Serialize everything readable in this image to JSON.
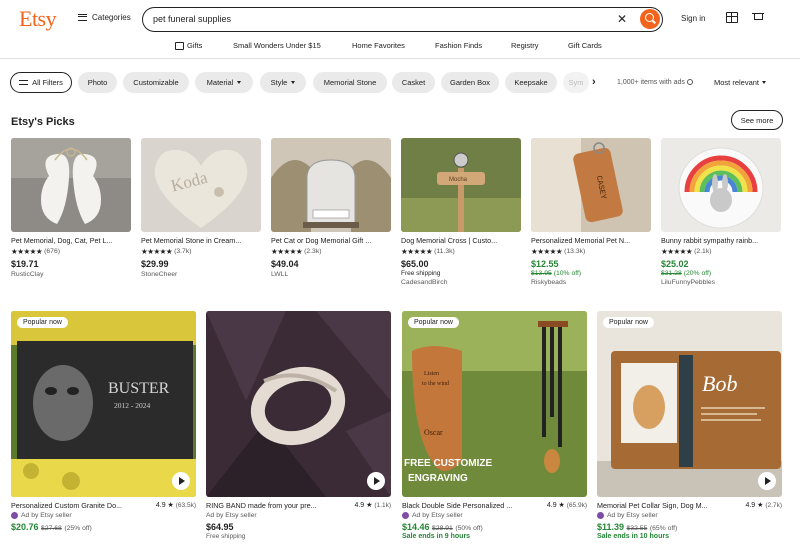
{
  "header": {
    "logo": "Etsy",
    "categories_label": "Categories",
    "search_value": "pet funeral supplies",
    "signin_label": "Sign in"
  },
  "nav": {
    "items": [
      "Gifts",
      "Small Wonders Under $15",
      "Home Favorites",
      "Fashion Finds",
      "Registry",
      "Gift Cards"
    ]
  },
  "filters": {
    "all_filters": "All Filters",
    "chips": [
      "Photo",
      "Customizable",
      "Material",
      "Style",
      "Memorial Stone",
      "Casket",
      "Garden Box",
      "Keepsake",
      "Sym"
    ],
    "results_count": "1,000+ items with ads",
    "sort_label": "Most relevant"
  },
  "picks": {
    "title": "Etsy's Picks",
    "see_more": "See more",
    "items": [
      {
        "title": "Pet Memorial, Dog, Cat, Pet L...",
        "stars": "★★★★★",
        "reviews": "(676)",
        "price": "$19.71",
        "orig": "",
        "pct": "",
        "ship": "",
        "shop": "RusticClay"
      },
      {
        "title": "Pet Memorial Stone in Cream...",
        "stars": "★★★★★",
        "reviews": "(3.7k)",
        "price": "$29.99",
        "orig": "",
        "pct": "",
        "ship": "",
        "shop": "StoneCheer"
      },
      {
        "title": "Pet Cat or Dog Memorial Gift ...",
        "stars": "★★★★★",
        "reviews": "(2.3k)",
        "price": "$49.04",
        "orig": "",
        "pct": "",
        "ship": "",
        "shop": "LWLL"
      },
      {
        "title": "Dog Memorial Cross | Custo...",
        "stars": "★★★★★",
        "reviews": "(11.3k)",
        "price": "$65.00",
        "orig": "",
        "pct": "",
        "ship": "Free shipping",
        "shop": "CadesandBirch"
      },
      {
        "title": "Personalized Memorial Pet N...",
        "stars": "★★★★★",
        "reviews": "(13.3k)",
        "price": "$12.55",
        "orig": "$13.95",
        "pct": "(10% off)",
        "ship": "",
        "shop": "Riskybeads"
      },
      {
        "title": "Bunny rabbit sympathy rainb...",
        "stars": "★★★★★",
        "reviews": "(2.1k)",
        "price": "$25.02",
        "orig": "$31.28",
        "pct": "(20% off)",
        "ship": "",
        "shop": "LiluFunnyPebbles"
      }
    ]
  },
  "cards": [
    {
      "popular": "Popular now",
      "title": "Personalized Custom Granite Do...",
      "rating": "4.9",
      "reviews": "(63.5k)",
      "ad": "Ad by Etsy seller",
      "price": "$20.76",
      "orig": "$27.68",
      "pct": "(25% off)",
      "ship": "",
      "ends": "",
      "img_text_1": "BUSTER",
      "img_text_2": "2012 - 2024"
    },
    {
      "popular": "",
      "title": "RING BAND made from your pre...",
      "rating": "4.9",
      "reviews": "(1.1k)",
      "ad": "Ad by Etsy seller",
      "price": "$64.95",
      "orig": "",
      "pct": "",
      "ship": "Free shipping",
      "ends": ""
    },
    {
      "popular": "Popular now",
      "title": "Black Double Side Personalized ...",
      "rating": "4.9",
      "reviews": "(65.9k)",
      "ad": "Ad by Etsy seller",
      "price": "$14.46",
      "orig": "$28.91",
      "pct": "(50% off)",
      "ship": "",
      "ends": "Sale ends in 9 hours",
      "img_text_1": "FREE CUSTOMIZE",
      "img_text_2": "ENGRAVING",
      "img_text_3": "Oscar"
    },
    {
      "popular": "Popular now",
      "title": "Memorial Pet Collar Sign, Dog M...",
      "rating": "4.9",
      "reviews": "(2.7k)",
      "ad": "Ad by Etsy seller",
      "price": "$11.39",
      "orig": "$32.55",
      "pct": "(65% off)",
      "ship": "",
      "ends": "Sale ends in 10 hours",
      "img_text_1": "Bob"
    }
  ],
  "colors": {
    "brand": "#f1641e",
    "sale": "#258635"
  },
  "icons": [
    "hamburger-icon",
    "clear-icon",
    "search-icon",
    "gift-icon",
    "cart-icon",
    "filter-icon",
    "chevron-right-icon",
    "info-icon",
    "play-icon"
  ]
}
